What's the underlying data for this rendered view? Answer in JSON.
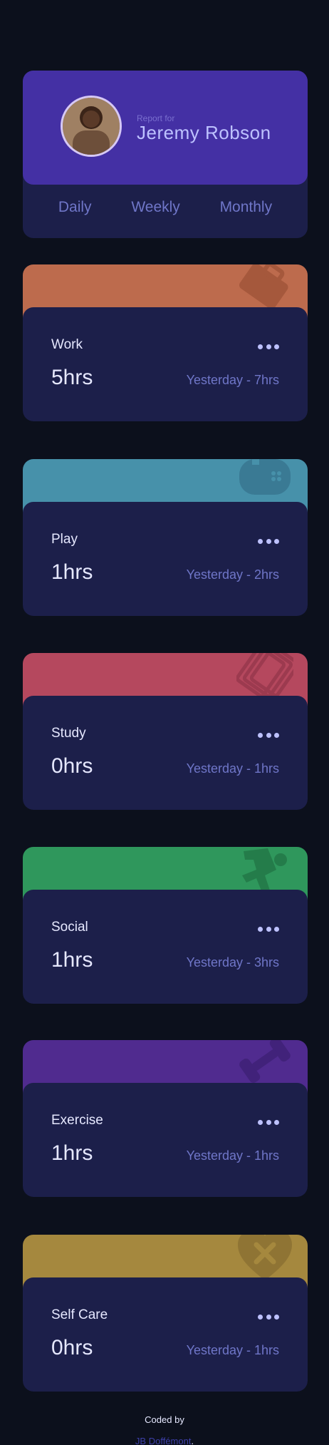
{
  "profile": {
    "report_for": "Report for",
    "name": "Jeremy Robson"
  },
  "tabs": [
    "Daily",
    "Weekly",
    "Monthly"
  ],
  "cards": [
    {
      "title": "Work",
      "current": "5hrs",
      "previous": "Yesterday - 7hrs",
      "color": "#ff8b64",
      "icon": "briefcase-icon"
    },
    {
      "title": "Play",
      "current": "1hrs",
      "previous": "Yesterday - 2hrs",
      "color": "#55c2e6",
      "icon": "gamepad-icon"
    },
    {
      "title": "Study",
      "current": "0hrs",
      "previous": "Yesterday - 1hrs",
      "color": "#ff5e7d",
      "icon": "books-icon"
    },
    {
      "title": "Social",
      "current": "1hrs",
      "previous": "Yesterday - 3hrs",
      "color": "#4bcf82",
      "icon": "runner-icon"
    },
    {
      "title": "Exercise",
      "current": "1hrs",
      "previous": "Yesterday - 1hrs",
      "color": "#7335d2",
      "icon": "dumbbell-icon"
    },
    {
      "title": "Self Care",
      "current": "0hrs",
      "previous": "Yesterday - 1hrs",
      "color": "#f1c75b",
      "icon": "heart-icon"
    }
  ],
  "attribution": {
    "coded_by": "Coded by",
    "author": "JB Doffémont",
    "period": "."
  }
}
